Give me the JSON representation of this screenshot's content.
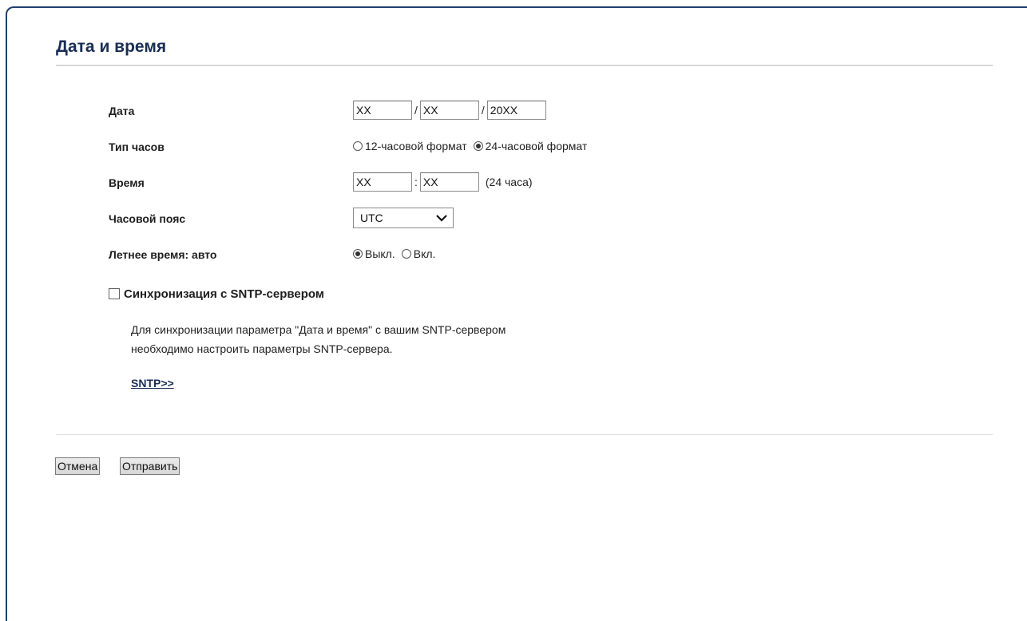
{
  "page": {
    "title": "Дата и время"
  },
  "date": {
    "label": "Дата",
    "day": "XX",
    "month": "XX",
    "year": "20XX",
    "separator": "/"
  },
  "clock_type": {
    "label": "Тип часов",
    "options": [
      {
        "label": "12-часовой формат",
        "selected": false
      },
      {
        "label": "24-часовой формат",
        "selected": true
      }
    ]
  },
  "time": {
    "label": "Время",
    "hours": "XX",
    "minutes": "XX",
    "separator": ":",
    "hint": "(24 часа)"
  },
  "time_zone": {
    "label": "Часовой пояс",
    "selected": "UTC"
  },
  "dst_auto": {
    "label": "Летнее время: авто",
    "options": [
      {
        "label": "Выкл.",
        "selected": true
      },
      {
        "label": "Вкл.",
        "selected": false
      }
    ]
  },
  "sntp": {
    "checkbox_label": "Синхронизация с SNTP-сервером",
    "checked": false,
    "description_line1": "Для синхронизации параметра \"Дата и время\" с вашим SNTP-сервером",
    "description_line2": "необходимо настроить параметры SNTP-сервера.",
    "link_label": "SNTP>>"
  },
  "buttons": {
    "cancel": "Отмена",
    "submit": "Отправить"
  },
  "colors": {
    "title": "#1a2e55",
    "frame_border": "#1f3f6e",
    "link": "#1a2e55"
  }
}
